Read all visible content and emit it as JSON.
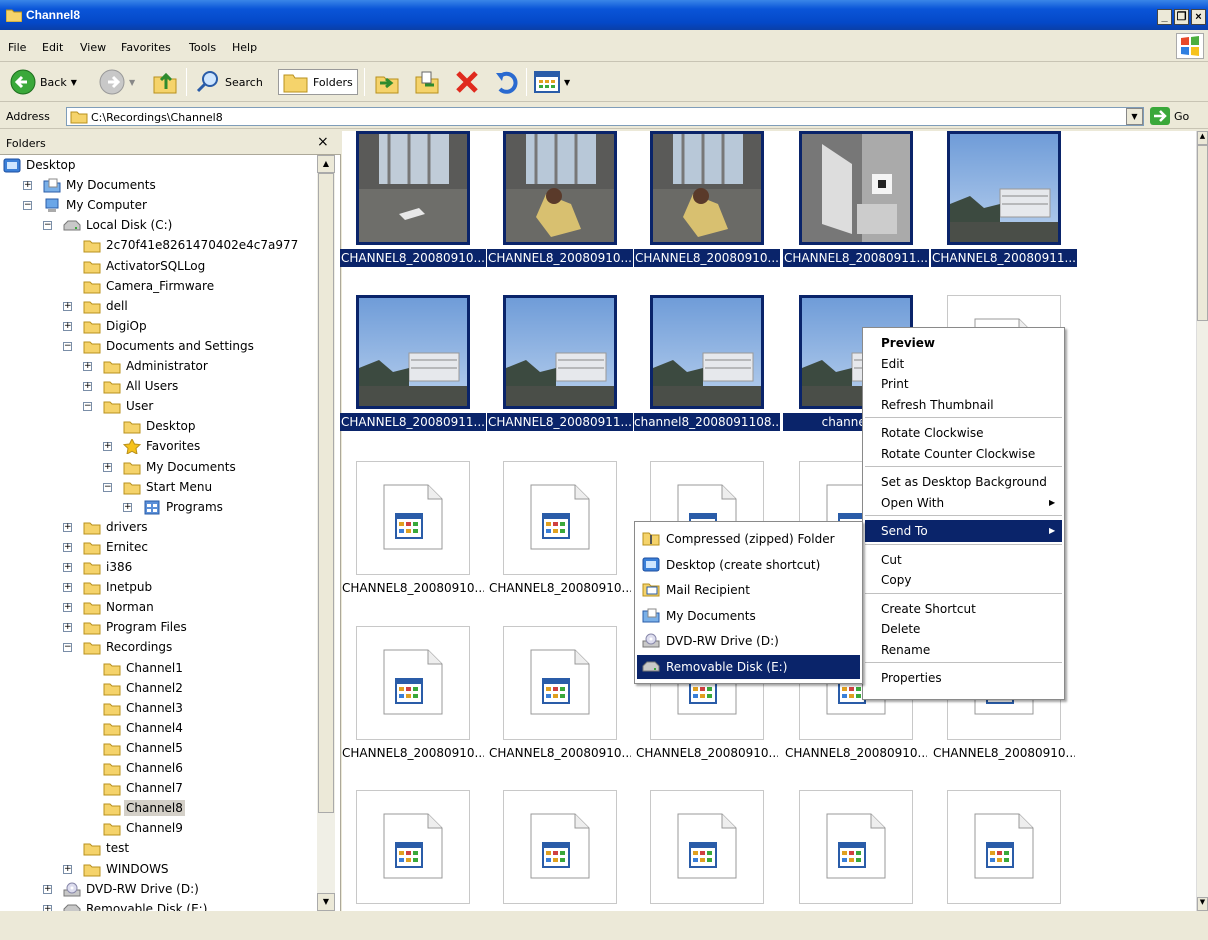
{
  "window": {
    "title": "Channel8",
    "controls": [
      "_",
      "×"
    ]
  },
  "menu": [
    "File",
    "Edit",
    "View",
    "Favorites",
    "Tools",
    "Help"
  ],
  "toolbar": {
    "back": "Back",
    "search": "Search",
    "folders": "Folders"
  },
  "address": {
    "label": "Address",
    "path": "C:\\Recordings\\Channel8",
    "go": "Go"
  },
  "folders_pane": {
    "title": "Folders",
    "close": "×"
  },
  "tree": [
    {
      "label": "Desktop",
      "indent": 0,
      "pm": "",
      "icon": "desktop"
    },
    {
      "label": "My Documents",
      "indent": 1,
      "pm": "+",
      "icon": "mydocs"
    },
    {
      "label": "My Computer",
      "indent": 1,
      "pm": "-",
      "icon": "computer"
    },
    {
      "label": "Local Disk (C:)",
      "indent": 2,
      "pm": "-",
      "icon": "drive"
    },
    {
      "label": "2c70f41e8261470402e4c7a977",
      "indent": 3,
      "pm": "",
      "icon": "folder"
    },
    {
      "label": "ActivatorSQLLog",
      "indent": 3,
      "pm": "",
      "icon": "folder"
    },
    {
      "label": "Camera_Firmware",
      "indent": 3,
      "pm": "",
      "icon": "folder"
    },
    {
      "label": "dell",
      "indent": 3,
      "pm": "+",
      "icon": "folder"
    },
    {
      "label": "DigiOp",
      "indent": 3,
      "pm": "+",
      "icon": "folder"
    },
    {
      "label": "Documents and Settings",
      "indent": 3,
      "pm": "-",
      "icon": "folder"
    },
    {
      "label": "Administrator",
      "indent": 4,
      "pm": "+",
      "icon": "folder"
    },
    {
      "label": "All Users",
      "indent": 4,
      "pm": "+",
      "icon": "folder"
    },
    {
      "label": "User",
      "indent": 4,
      "pm": "-",
      "icon": "folder"
    },
    {
      "label": "Desktop",
      "indent": 5,
      "pm": "",
      "icon": "folder"
    },
    {
      "label": "Favorites",
      "indent": 5,
      "pm": "+",
      "icon": "star"
    },
    {
      "label": "My Documents",
      "indent": 5,
      "pm": "+",
      "icon": "folder"
    },
    {
      "label": "Start Menu",
      "indent": 5,
      "pm": "-",
      "icon": "folder"
    },
    {
      "label": "Programs",
      "indent": 6,
      "pm": "+",
      "icon": "programs"
    },
    {
      "label": "drivers",
      "indent": 3,
      "pm": "+",
      "icon": "folder"
    },
    {
      "label": "Ernitec",
      "indent": 3,
      "pm": "+",
      "icon": "folder"
    },
    {
      "label": "i386",
      "indent": 3,
      "pm": "+",
      "icon": "folder"
    },
    {
      "label": "Inetpub",
      "indent": 3,
      "pm": "+",
      "icon": "folder"
    },
    {
      "label": "Norman",
      "indent": 3,
      "pm": "+",
      "icon": "folder"
    },
    {
      "label": "Program Files",
      "indent": 3,
      "pm": "+",
      "icon": "folder"
    },
    {
      "label": "Recordings",
      "indent": 3,
      "pm": "-",
      "icon": "folder"
    },
    {
      "label": "Channel1",
      "indent": 4,
      "pm": "",
      "icon": "folder"
    },
    {
      "label": "Channel2",
      "indent": 4,
      "pm": "",
      "icon": "folder"
    },
    {
      "label": "Channel3",
      "indent": 4,
      "pm": "",
      "icon": "folder"
    },
    {
      "label": "Channel4",
      "indent": 4,
      "pm": "",
      "icon": "folder"
    },
    {
      "label": "Channel5",
      "indent": 4,
      "pm": "",
      "icon": "folder"
    },
    {
      "label": "Channel6",
      "indent": 4,
      "pm": "",
      "icon": "folder"
    },
    {
      "label": "Channel7",
      "indent": 4,
      "pm": "",
      "icon": "folder"
    },
    {
      "label": "Channel8",
      "indent": 4,
      "pm": "",
      "icon": "folder",
      "selected": true
    },
    {
      "label": "Channel9",
      "indent": 4,
      "pm": "",
      "icon": "folder"
    },
    {
      "label": "test",
      "indent": 3,
      "pm": "",
      "icon": "folder"
    },
    {
      "label": "WINDOWS",
      "indent": 3,
      "pm": "+",
      "icon": "folder"
    },
    {
      "label": "DVD-RW Drive (D:)",
      "indent": 2,
      "pm": "+",
      "icon": "dvd"
    },
    {
      "label": "Removable Disk (E:)",
      "indent": 2,
      "pm": "+",
      "icon": "drive"
    }
  ],
  "items": [
    {
      "caption": "CHANNEL8_20080910...",
      "kind": "photo-room",
      "selected": true
    },
    {
      "caption": "CHANNEL8_20080910...",
      "kind": "photo-room2",
      "selected": true
    },
    {
      "caption": "CHANNEL8_20080910...",
      "kind": "photo-room2",
      "selected": true
    },
    {
      "caption": "CHANNEL8_20080911...",
      "kind": "photo-gray",
      "selected": true
    },
    {
      "caption": "CHANNEL8_20080911...",
      "kind": "photo-sky",
      "selected": true
    },
    {
      "caption": "CHANNEL8_20080911...",
      "kind": "photo-sky",
      "selected": true
    },
    {
      "caption": "CHANNEL8_20080911...",
      "kind": "photo-sky",
      "selected": true
    },
    {
      "caption": "channel8_2008091108...",
      "kind": "photo-sky",
      "selected": true
    },
    {
      "caption": "channel8_2",
      "kind": "photo-sky",
      "selected": true
    },
    {
      "caption": "...",
      "kind": "file",
      "selected": false
    },
    {
      "caption": "CHANNEL8_20080910...",
      "kind": "file",
      "selected": false
    },
    {
      "caption": "CHANNEL8_20080910...",
      "kind": "file",
      "selected": false
    },
    {
      "caption": "",
      "kind": "file",
      "selected": false
    },
    {
      "caption": "",
      "kind": "file",
      "selected": false
    },
    {
      "caption": "...",
      "kind": "file",
      "selected": false
    },
    {
      "caption": "CHANNEL8_20080910...",
      "kind": "file",
      "selected": false
    },
    {
      "caption": "CHANNEL8_20080910...",
      "kind": "file",
      "selected": false
    },
    {
      "caption": "CHANNEL8_20080910...",
      "kind": "file",
      "selected": false
    },
    {
      "caption": "CHANNEL8_20080910...",
      "kind": "file",
      "selected": false
    },
    {
      "caption": "CHANNEL8_20080910...",
      "kind": "file",
      "selected": false
    },
    {
      "caption": "",
      "kind": "file",
      "selected": false
    },
    {
      "caption": "",
      "kind": "file",
      "selected": false
    },
    {
      "caption": "",
      "kind": "file",
      "selected": false
    },
    {
      "caption": "",
      "kind": "file",
      "selected": false
    },
    {
      "caption": "",
      "kind": "file",
      "selected": false
    }
  ],
  "context_menu": {
    "items": [
      {
        "label": "Preview",
        "bold": true
      },
      {
        "label": "Edit"
      },
      {
        "label": "Print"
      },
      {
        "label": "Refresh Thumbnail"
      },
      {
        "sep": true
      },
      {
        "label": "Rotate Clockwise"
      },
      {
        "label": "Rotate Counter Clockwise"
      },
      {
        "sep": true
      },
      {
        "label": "Set as Desktop Background"
      },
      {
        "label": "Open With",
        "arrow": true
      },
      {
        "sep": true
      },
      {
        "label": "Send To",
        "arrow": true,
        "highlighted": true
      },
      {
        "sep": true
      },
      {
        "label": "Cut"
      },
      {
        "label": "Copy"
      },
      {
        "sep": true
      },
      {
        "label": "Create Shortcut"
      },
      {
        "label": "Delete"
      },
      {
        "label": "Rename"
      },
      {
        "sep": true
      },
      {
        "label": "Properties"
      }
    ]
  },
  "send_to_menu": {
    "items": [
      {
        "label": "Compressed (zipped) Folder",
        "icon": "zip-folder-icon"
      },
      {
        "label": "Desktop (create shortcut)",
        "icon": "desktop-icon"
      },
      {
        "label": "Mail Recipient",
        "icon": "mail-icon"
      },
      {
        "label": "My Documents",
        "icon": "my-documents-icon"
      },
      {
        "label": "DVD-RW Drive (D:)",
        "icon": "dvd-drive-icon"
      },
      {
        "label": "Removable Disk (E:)",
        "icon": "removable-disk-icon",
        "highlighted": true
      }
    ]
  },
  "colors": {
    "selection": "#0a246a",
    "title_bar": "#0a55d8",
    "chrome": "#ece9d8"
  }
}
